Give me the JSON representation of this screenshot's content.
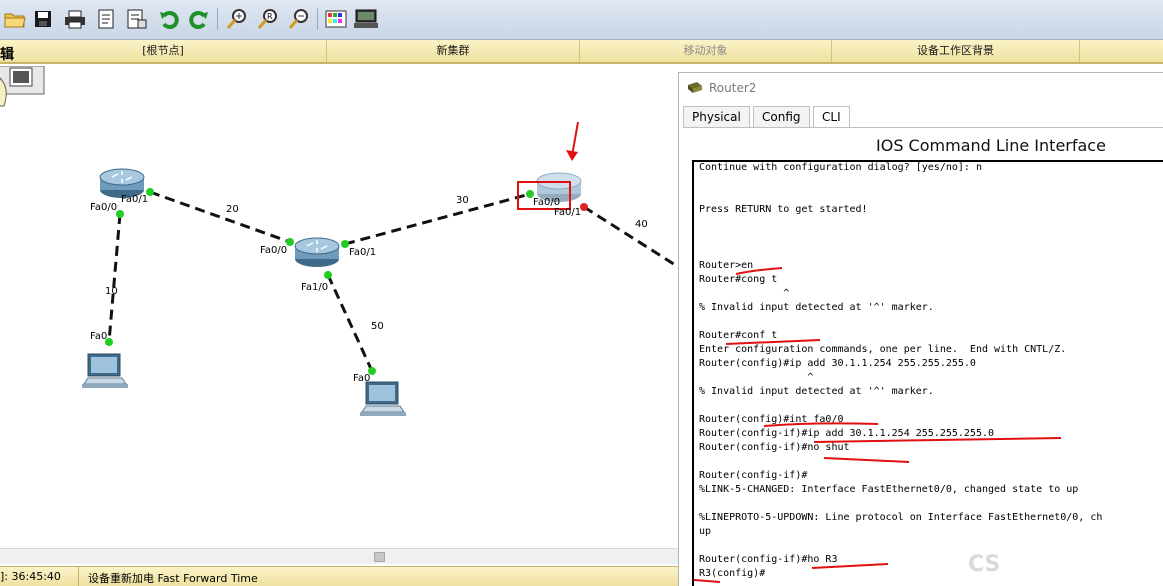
{
  "toolbar": {
    "icons": [
      "open-folder-icon",
      "save-icon",
      "print-icon",
      "activity-wizard-icon",
      "activity-wizard-2-icon",
      "undo-icon",
      "redo-icon",
      "zoom-in-icon",
      "zoom-reset-icon",
      "zoom-out-icon",
      "palette-icon",
      "custom-device-icon"
    ]
  },
  "tabstrip": {
    "edit_label": "辑",
    "tabs": [
      "[根节点]",
      "新集群",
      "移动对象",
      "设备工作区背景"
    ]
  },
  "topology": {
    "links": {
      "l10": "10",
      "l20": "20",
      "l30": "30",
      "l40": "40",
      "l50": "50"
    },
    "ports": {
      "r1_fa00": "Fa0/0",
      "r1_fa01": "Fa0/1",
      "r2_fa00": "Fa0/0",
      "r2_fa01": "Fa0/1",
      "r2_fa10": "Fa1/0",
      "r3_fa00": "Fa0/0",
      "r3_fa01": "Fa0/1",
      "pc1_fa0": "Fa0",
      "pc2_fa0": "Fa0"
    }
  },
  "status": {
    "time": "]: 36:45:40",
    "mode": "设备重新加电  Fast Forward Time"
  },
  "router_window": {
    "title": "Router2",
    "tabs": [
      "Physical",
      "Config",
      "CLI"
    ],
    "active_tab": "CLI",
    "heading": "IOS Command Line Interface",
    "cli_lines": [
      "Continue with configuration dialog? [yes/no]: n",
      "",
      "",
      "Press RETURN to get started!",
      "",
      "",
      "",
      "Router>en",
      "Router#cong t",
      "              ^",
      "% Invalid input detected at '^' marker.",
      "",
      "Router#conf t",
      "Enter configuration commands, one per line.  End with CNTL/Z.",
      "Router(config)#ip add 30.1.1.254 255.255.255.0",
      "                  ^",
      "% Invalid input detected at '^' marker.",
      "",
      "Router(config)#int fa0/0",
      "Router(config-if)#ip add 30.1.1.254 255.255.255.0",
      "Router(config-if)#no shut",
      "",
      "Router(config-if)#",
      "%LINK-5-CHANGED: Interface FastEthernet0/0, changed state to up",
      "",
      "%LINEPROTO-5-UPDOWN: Line protocol on Interface FastEthernet0/0, ch",
      "up",
      "",
      "Router(config-if)#ho R3",
      "R3(config)#"
    ]
  },
  "watermark": "CS",
  "colors": {
    "link_up": "#22cc22",
    "link_down": "#dd2222",
    "annotation": "#e01010"
  }
}
